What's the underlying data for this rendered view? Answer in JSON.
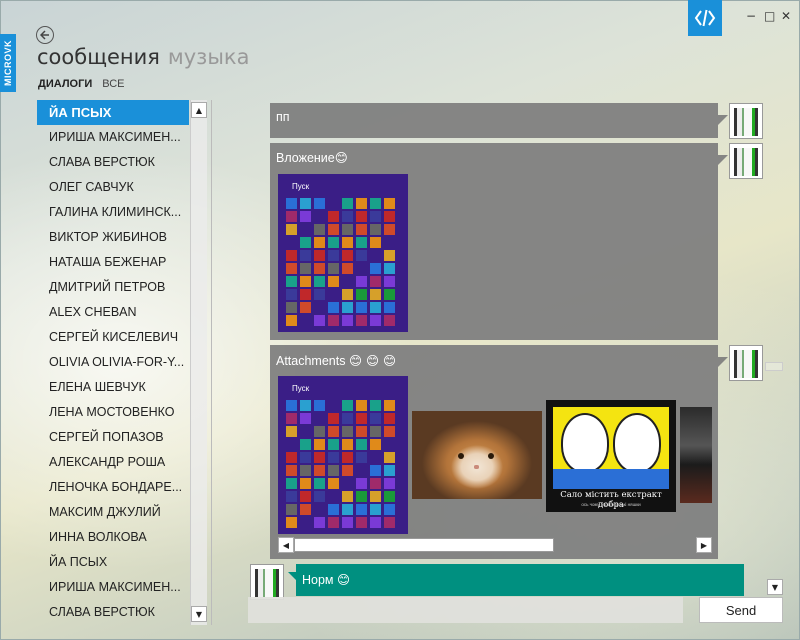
{
  "app": {
    "side_tab_label": "MICROVK",
    "title": "сообщения",
    "title_secondary": "музыка",
    "subtabs": [
      "ДИАЛОГИ",
      "ВСЕ"
    ],
    "accent_color": "#1a90d9",
    "icons": {
      "badge": "code-brackets-icon",
      "minimize": "minimize-icon",
      "maximize": "maximize-icon",
      "close": "close-icon",
      "back": "back-arrow-icon"
    }
  },
  "window_controls": {
    "minimize": "−",
    "maximize": "□",
    "close": "✕"
  },
  "dialogs": [
    "ЙА ПСЫХ",
    "ИРИША МАКСИМЕН...",
    "СЛАВА ВЕРСТЮК",
    "ОЛЕГ САВЧУК",
    "ГАЛИНА КЛИМИНСК...",
    "ВИКТОР ЖИБИНОВ",
    "НАТАША БЕЖЕНАР",
    "ДМИТРИЙ ПЕТРОВ",
    "ALEX CHEBAN",
    "СЕРГЕЙ КИСЕЛЕВИЧ",
    "OLIVIA OLIVIA-FOR-Y...",
    "ЕЛЕНА ШЕВЧУК",
    "ЛЕНА МОСТОВЕНКО",
    "СЕРГЕЙ ПОПАЗОВ",
    "АЛЕКСАНДР РОША",
    "ЛЕНОЧКА БОНДАРЕ...",
    "МАКСИМ ДЖУЛИЙ",
    "ИННА ВОЛКОВА",
    "ЙА ПСЫХ",
    "ИРИША МАКСИМЕН...",
    "СЛАВА ВЕРСТЮК"
  ],
  "selected_dialog": "ЙА ПСЫХ",
  "messages": [
    {
      "text": "пп",
      "attachments": []
    },
    {
      "text": "Вложение",
      "emoji": "😊",
      "attachments": [
        "windows-start-screen"
      ]
    },
    {
      "text": "Attachments",
      "emoji": "😊 😊 😊",
      "attachments": [
        "windows-start-screen",
        "cat-photo",
        "meme-image",
        "laptop-photo"
      ]
    }
  ],
  "start_screen_label": "Пуск",
  "meme": {
    "caption": "Сало містить екстракт добра",
    "subcaption": "ось чому українці такі няшки"
  },
  "my_message": {
    "text": "Норм",
    "emoji": "😊",
    "color": "#009080"
  },
  "compose": {
    "placeholder": "",
    "value": ""
  },
  "send_label": "Send",
  "scroll_arrows": {
    "up": "▲",
    "down": "▼",
    "left": "◀",
    "right": "▶"
  }
}
